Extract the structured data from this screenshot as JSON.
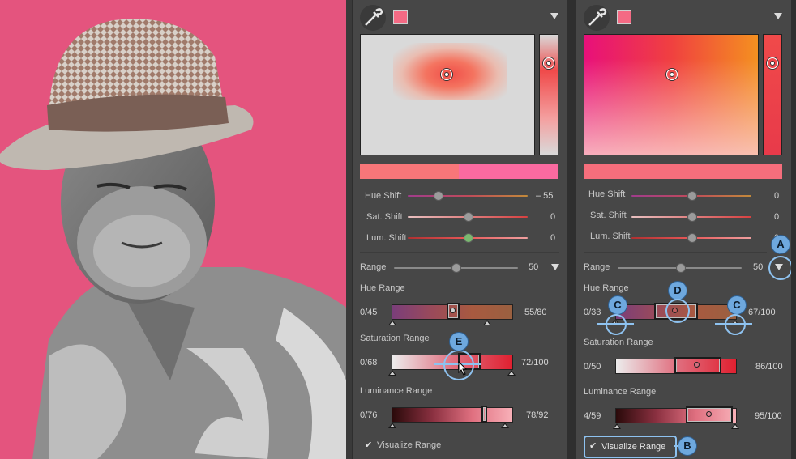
{
  "colors": {
    "accent_pink": "#f46a84",
    "photo_bg": "#e4547e",
    "highlight": "#6ea8de"
  },
  "panel1": {
    "hue_shift": {
      "label": "Hue Shift",
      "value": "– 55"
    },
    "sat_shift": {
      "label": "Sat. Shift",
      "value": "0"
    },
    "lum_shift": {
      "label": "Lum. Shift",
      "value": "0"
    },
    "range": {
      "label": "Range",
      "value": "50"
    },
    "hue_range": {
      "label": "Hue Range",
      "min": "0/45",
      "max": "55/80"
    },
    "saturation_range": {
      "label": "Saturation Range",
      "min": "0/68",
      "max": "72/100"
    },
    "luminance_range": {
      "label": "Luminance Range",
      "min": "0/76",
      "max": "78/92"
    },
    "visualize": {
      "label": "Visualize Range",
      "checked": true
    }
  },
  "panel2": {
    "hue_shift": {
      "label": "Hue Shift",
      "value": "0"
    },
    "sat_shift": {
      "label": "Sat. Shift",
      "value": "0"
    },
    "lum_shift": {
      "label": "Lum. Shift",
      "value": "0"
    },
    "range": {
      "label": "Range",
      "value": "50"
    },
    "hue_range": {
      "label": "Hue Range",
      "min": "0/33",
      "max": "67/100"
    },
    "saturation_range": {
      "label": "Saturation Range",
      "min": "0/50",
      "max": "86/100"
    },
    "luminance_range": {
      "label": "Luminance Range",
      "min": "4/59",
      "max": "95/100"
    },
    "visualize": {
      "label": "Visualize Range",
      "checked": true
    }
  },
  "callouts": {
    "a": "A",
    "b": "B",
    "c": "C",
    "d": "D",
    "e": "E"
  },
  "icons": {
    "eyedropper": "eyedropper-icon",
    "dropdown": "chevron-down-icon",
    "checkbox": "checkbox-icon",
    "cursor": "cursor-icon"
  }
}
